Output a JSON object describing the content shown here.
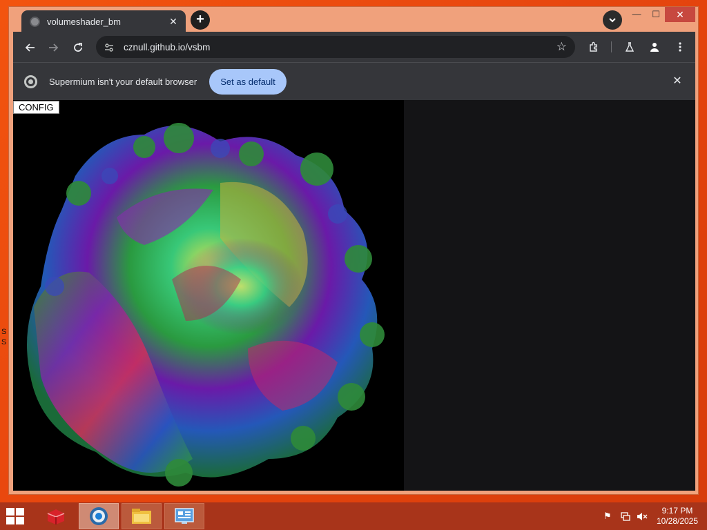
{
  "browser": {
    "tab_title": "volumeshader_bm",
    "tab_close": "✕",
    "new_tab": "+",
    "window": {
      "minimize": "—",
      "maximize": "☐",
      "close": "✕"
    },
    "url": "cznull.github.io/vsbm"
  },
  "infobar": {
    "message": "Supermium isn't your default browser",
    "button": "Set as default",
    "close": "✕"
  },
  "page": {
    "config_button": "CONFIG"
  },
  "desktop": {
    "edge_glyphs": [
      "S",
      "S"
    ]
  },
  "taskbar": {
    "time": "9:17 PM",
    "date": "10/28/2025"
  },
  "colors": {
    "desktop": "#e8470e",
    "taskbar": "#a8341a",
    "window_frame": "#f0a17c",
    "toolbar": "#35363a",
    "accent_button": "#a8c7fa"
  }
}
